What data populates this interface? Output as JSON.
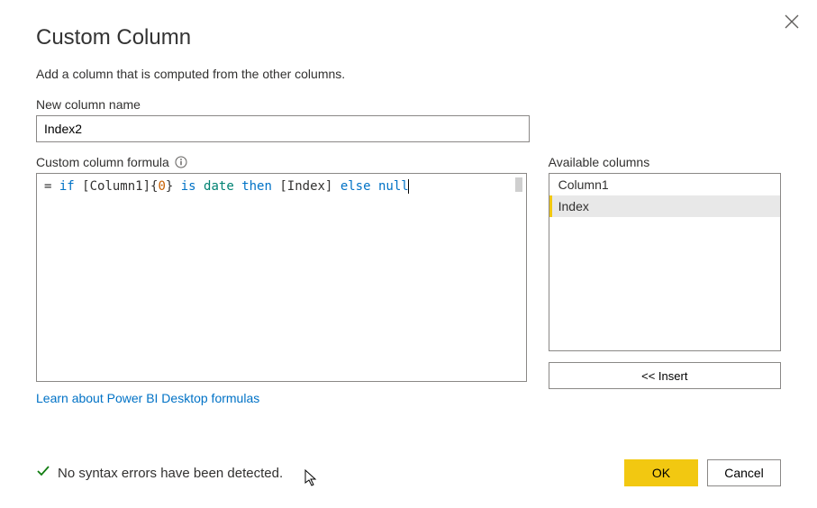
{
  "dialog": {
    "title": "Custom Column",
    "description": "Add a column that is computed from the other columns.",
    "new_column_name_label": "New column name",
    "new_column_name_value": "Index2",
    "formula_label": "Custom column formula",
    "formula": {
      "prefix": "= ",
      "tokens": {
        "if": "if",
        "ref1": "[Column1]{",
        "num0": "0",
        "ref1b": "} ",
        "is": "is",
        "type": "date",
        "then": "then",
        "ref2": "[Index]",
        "else": "else",
        "null": "null"
      }
    },
    "available_label": "Available columns",
    "available_columns": [
      "Column1",
      "Index"
    ],
    "selected_column_index": 1,
    "insert_button": "<< Insert",
    "learn_link": "Learn about Power BI Desktop formulas",
    "status_text": "No syntax errors have been detected.",
    "ok_button": "OK",
    "cancel_button": "Cancel"
  }
}
